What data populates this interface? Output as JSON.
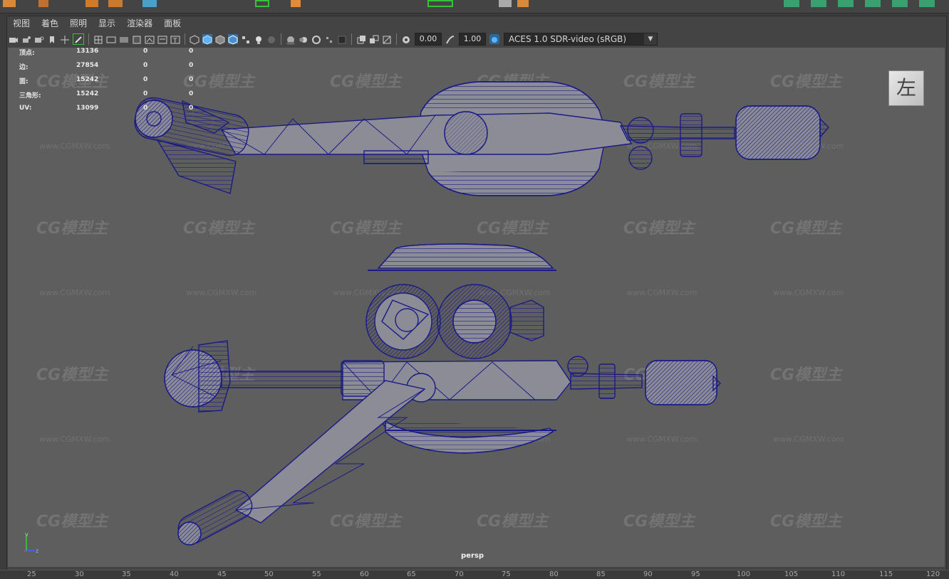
{
  "menu": {
    "items": [
      "视图",
      "着色",
      "照明",
      "显示",
      "渲染器",
      "面板"
    ]
  },
  "toolbar": {
    "exposure_value": "0.00",
    "gamma_value": "1.00",
    "color_space": "ACES 1.0 SDR-video (sRGB)"
  },
  "hud": {
    "rows": [
      {
        "label": "顶点:",
        "value": "13136",
        "sel": "0",
        "comp": "0"
      },
      {
        "label": "边:",
        "value": "27854",
        "sel": "0",
        "comp": "0"
      },
      {
        "label": "面:",
        "value": "15242",
        "sel": "0",
        "comp": "0"
      },
      {
        "label": "三角形:",
        "value": "15242",
        "sel": "0",
        "comp": "0"
      },
      {
        "label": "UV:",
        "value": "13099",
        "sel": "0",
        "comp": "0"
      }
    ]
  },
  "viewcube": {
    "label": "左"
  },
  "camera": {
    "label": "persp"
  },
  "axis": {
    "y": "y",
    "z": "z"
  },
  "watermark": {
    "logo": "CG模型主",
    "url": "www.CGMXW.com"
  },
  "ruler": {
    "ticks": [
      "25",
      "30",
      "35",
      "40",
      "45",
      "50",
      "55",
      "60",
      "65",
      "70",
      "75",
      "80",
      "85",
      "90",
      "95",
      "100",
      "105",
      "110",
      "115",
      "120"
    ]
  },
  "colors": {
    "wire": "#1a1a86",
    "mesh": "#8c8c96",
    "viewport_bg": "#5e5e5e",
    "accent": "#5ab4ff"
  }
}
